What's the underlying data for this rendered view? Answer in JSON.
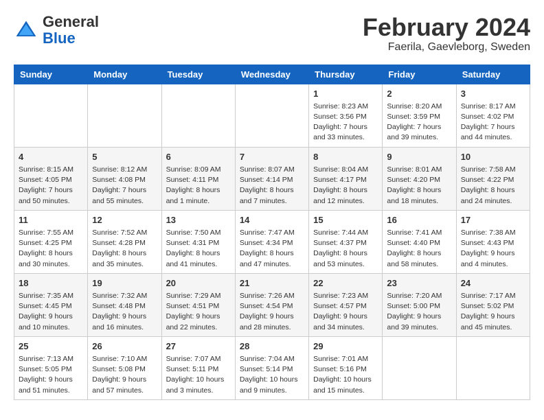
{
  "header": {
    "logo_general": "General",
    "logo_blue": "Blue",
    "month_year": "February 2024",
    "location": "Faerila, Gaevleborg, Sweden"
  },
  "weekdays": [
    "Sunday",
    "Monday",
    "Tuesday",
    "Wednesday",
    "Thursday",
    "Friday",
    "Saturday"
  ],
  "weeks": [
    {
      "shaded": false,
      "days": [
        {
          "num": "",
          "info": ""
        },
        {
          "num": "",
          "info": ""
        },
        {
          "num": "",
          "info": ""
        },
        {
          "num": "",
          "info": ""
        },
        {
          "num": "1",
          "info": "Sunrise: 8:23 AM\nSunset: 3:56 PM\nDaylight: 7 hours\nand 33 minutes."
        },
        {
          "num": "2",
          "info": "Sunrise: 8:20 AM\nSunset: 3:59 PM\nDaylight: 7 hours\nand 39 minutes."
        },
        {
          "num": "3",
          "info": "Sunrise: 8:17 AM\nSunset: 4:02 PM\nDaylight: 7 hours\nand 44 minutes."
        }
      ]
    },
    {
      "shaded": true,
      "days": [
        {
          "num": "4",
          "info": "Sunrise: 8:15 AM\nSunset: 4:05 PM\nDaylight: 7 hours\nand 50 minutes."
        },
        {
          "num": "5",
          "info": "Sunrise: 8:12 AM\nSunset: 4:08 PM\nDaylight: 7 hours\nand 55 minutes."
        },
        {
          "num": "6",
          "info": "Sunrise: 8:09 AM\nSunset: 4:11 PM\nDaylight: 8 hours\nand 1 minute."
        },
        {
          "num": "7",
          "info": "Sunrise: 8:07 AM\nSunset: 4:14 PM\nDaylight: 8 hours\nand 7 minutes."
        },
        {
          "num": "8",
          "info": "Sunrise: 8:04 AM\nSunset: 4:17 PM\nDaylight: 8 hours\nand 12 minutes."
        },
        {
          "num": "9",
          "info": "Sunrise: 8:01 AM\nSunset: 4:20 PM\nDaylight: 8 hours\nand 18 minutes."
        },
        {
          "num": "10",
          "info": "Sunrise: 7:58 AM\nSunset: 4:22 PM\nDaylight: 8 hours\nand 24 minutes."
        }
      ]
    },
    {
      "shaded": false,
      "days": [
        {
          "num": "11",
          "info": "Sunrise: 7:55 AM\nSunset: 4:25 PM\nDaylight: 8 hours\nand 30 minutes."
        },
        {
          "num": "12",
          "info": "Sunrise: 7:52 AM\nSunset: 4:28 PM\nDaylight: 8 hours\nand 35 minutes."
        },
        {
          "num": "13",
          "info": "Sunrise: 7:50 AM\nSunset: 4:31 PM\nDaylight: 8 hours\nand 41 minutes."
        },
        {
          "num": "14",
          "info": "Sunrise: 7:47 AM\nSunset: 4:34 PM\nDaylight: 8 hours\nand 47 minutes."
        },
        {
          "num": "15",
          "info": "Sunrise: 7:44 AM\nSunset: 4:37 PM\nDaylight: 8 hours\nand 53 minutes."
        },
        {
          "num": "16",
          "info": "Sunrise: 7:41 AM\nSunset: 4:40 PM\nDaylight: 8 hours\nand 58 minutes."
        },
        {
          "num": "17",
          "info": "Sunrise: 7:38 AM\nSunset: 4:43 PM\nDaylight: 9 hours\nand 4 minutes."
        }
      ]
    },
    {
      "shaded": true,
      "days": [
        {
          "num": "18",
          "info": "Sunrise: 7:35 AM\nSunset: 4:45 PM\nDaylight: 9 hours\nand 10 minutes."
        },
        {
          "num": "19",
          "info": "Sunrise: 7:32 AM\nSunset: 4:48 PM\nDaylight: 9 hours\nand 16 minutes."
        },
        {
          "num": "20",
          "info": "Sunrise: 7:29 AM\nSunset: 4:51 PM\nDaylight: 9 hours\nand 22 minutes."
        },
        {
          "num": "21",
          "info": "Sunrise: 7:26 AM\nSunset: 4:54 PM\nDaylight: 9 hours\nand 28 minutes."
        },
        {
          "num": "22",
          "info": "Sunrise: 7:23 AM\nSunset: 4:57 PM\nDaylight: 9 hours\nand 34 minutes."
        },
        {
          "num": "23",
          "info": "Sunrise: 7:20 AM\nSunset: 5:00 PM\nDaylight: 9 hours\nand 39 minutes."
        },
        {
          "num": "24",
          "info": "Sunrise: 7:17 AM\nSunset: 5:02 PM\nDaylight: 9 hours\nand 45 minutes."
        }
      ]
    },
    {
      "shaded": false,
      "days": [
        {
          "num": "25",
          "info": "Sunrise: 7:13 AM\nSunset: 5:05 PM\nDaylight: 9 hours\nand 51 minutes."
        },
        {
          "num": "26",
          "info": "Sunrise: 7:10 AM\nSunset: 5:08 PM\nDaylight: 9 hours\nand 57 minutes."
        },
        {
          "num": "27",
          "info": "Sunrise: 7:07 AM\nSunset: 5:11 PM\nDaylight: 10 hours\nand 3 minutes."
        },
        {
          "num": "28",
          "info": "Sunrise: 7:04 AM\nSunset: 5:14 PM\nDaylight: 10 hours\nand 9 minutes."
        },
        {
          "num": "29",
          "info": "Sunrise: 7:01 AM\nSunset: 5:16 PM\nDaylight: 10 hours\nand 15 minutes."
        },
        {
          "num": "",
          "info": ""
        },
        {
          "num": "",
          "info": ""
        }
      ]
    }
  ]
}
